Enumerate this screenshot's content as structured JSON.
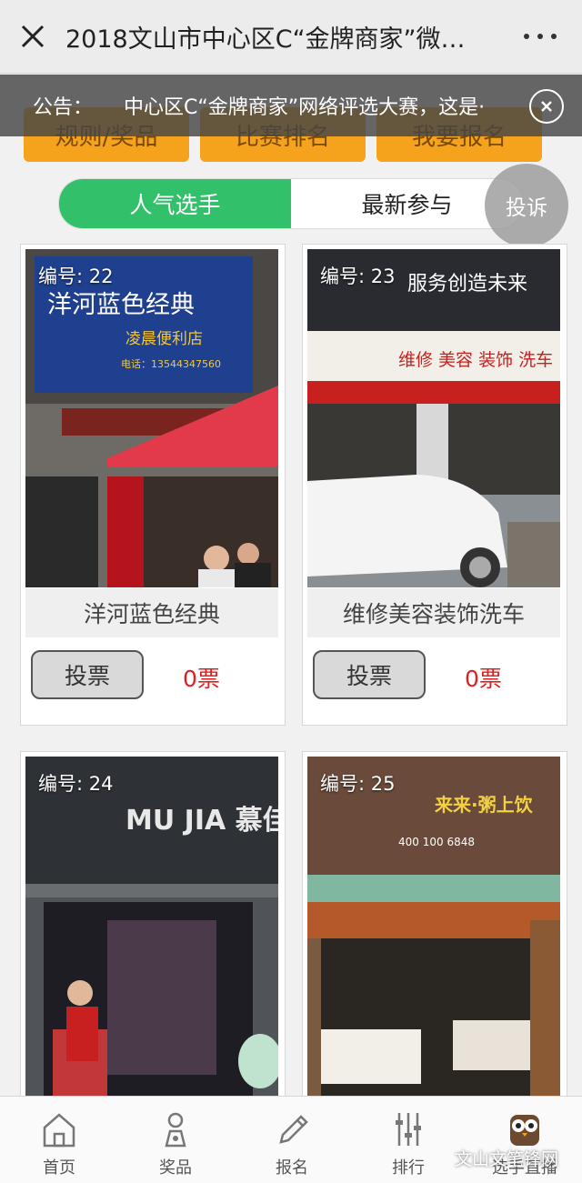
{
  "header": {
    "title": "2018文山市中心区C“金牌商家”微…"
  },
  "top_buttons": [
    "规则/奖品",
    "比赛排名",
    "我要报名"
  ],
  "notice": {
    "label": "公告：",
    "text": "中心区C“金牌商家”网络评选大赛，这是·"
  },
  "segments": {
    "popular": "人气选手",
    "latest": "最新参与"
  },
  "complaint_label": "投诉",
  "contestants": [
    {
      "number": "编号: 22",
      "name": "洋河蓝色经典",
      "vote_label": "投票",
      "votes": "0票",
      "sign_text": "洋河蓝色经典",
      "sign_sub": "凌晨便利店",
      "sign_phone": "电话：13544347560"
    },
    {
      "number": "编号: 23",
      "name": "维修美容装饰洗车",
      "vote_label": "投票",
      "votes": "0票",
      "sign_text": "服务创造未来",
      "sign_sub": "维修 美容 装饰 洗车"
    },
    {
      "number": "编号: 24",
      "name": "",
      "sign_text": "MU JIA 慕佳"
    },
    {
      "number": "编号: 25",
      "name": "",
      "sign_text": "来来·粥上饮",
      "sign_phone": "400 100 6848"
    }
  ],
  "nav": [
    {
      "label": "首页",
      "icon": "home-icon"
    },
    {
      "label": "奖品",
      "icon": "gift-icon"
    },
    {
      "label": "报名",
      "icon": "pencil-icon"
    },
    {
      "label": "排行",
      "icon": "ranking-icon"
    },
    {
      "label": "选手直播",
      "icon": "owl-icon"
    }
  ],
  "watermark": "文山文笔锋网",
  "colors": {
    "accent_green": "#33c06b",
    "orange": "#f5a21c",
    "vote_red": "#e02020"
  }
}
